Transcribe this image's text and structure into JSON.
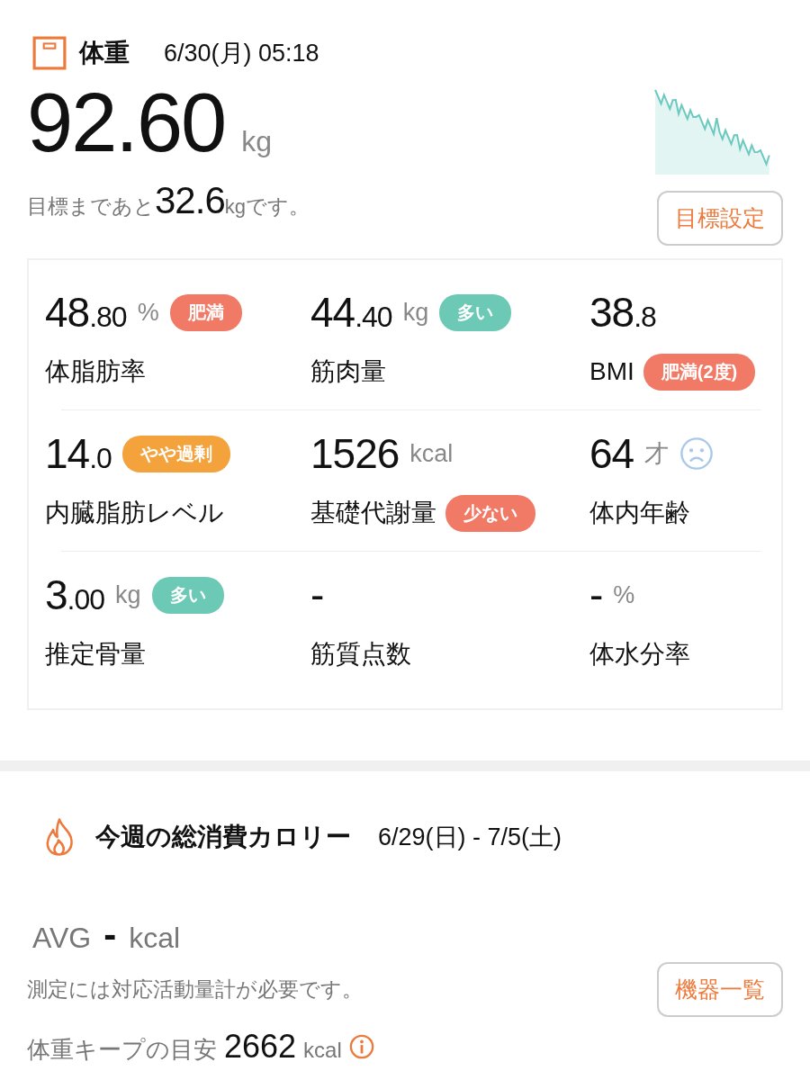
{
  "weight": {
    "title": "体重",
    "datetime": "6/30(月) 05:18",
    "value": "92.60",
    "unit": "kg",
    "goal_prefix": "目標まであと",
    "goal_value": "32.6",
    "goal_unit": "kg",
    "goal_suffix": "です。",
    "goal_button": "目標設定"
  },
  "metrics": [
    {
      "int": "48",
      "dec": ".80",
      "unit": "%",
      "label": "体脂肪率",
      "value_badge": {
        "text": "肥満",
        "color": "#f07a66"
      }
    },
    {
      "int": "44",
      "dec": ".40",
      "unit": "kg",
      "label": "筋肉量",
      "value_badge": {
        "text": "多い",
        "color": "#6cc9b5"
      }
    },
    {
      "int": "38",
      "dec": ".8",
      "label": "BMI",
      "label_badge": {
        "text": "肥満(2度)",
        "color": "#f07a66"
      }
    },
    {
      "int": "14",
      "dec": ".0",
      "label": "内臓脂肪レベル",
      "value_badge": {
        "text": "やや過剰",
        "color": "#f4a23c"
      }
    },
    {
      "int": "1526",
      "unit": "kcal",
      "label": "基礎代謝量",
      "label_badge": {
        "text": "少ない",
        "color": "#f07a66"
      }
    },
    {
      "int": "64",
      "unit": "才",
      "label": "体内年齢",
      "unhappy": true
    },
    {
      "int": "3",
      "dec": ".00",
      "unit": "kg",
      "label": "推定骨量",
      "value_badge": {
        "text": "多い",
        "color": "#6cc9b5"
      }
    },
    {
      "int": "-",
      "label": "筋質点数"
    },
    {
      "int": "-",
      "unit": "%",
      "label": "体水分率"
    }
  ],
  "calories": {
    "title": "今週の総消費カロリー",
    "range": "6/29(日) - 7/5(土)",
    "avg_label": "AVG",
    "avg_value": "-",
    "avg_unit": "kcal",
    "note": "測定には対応活動量計が必要です。",
    "devices_button": "機器一覧",
    "keep_label": "体重キープの目安",
    "keep_value": "2662",
    "keep_unit": "kcal"
  }
}
